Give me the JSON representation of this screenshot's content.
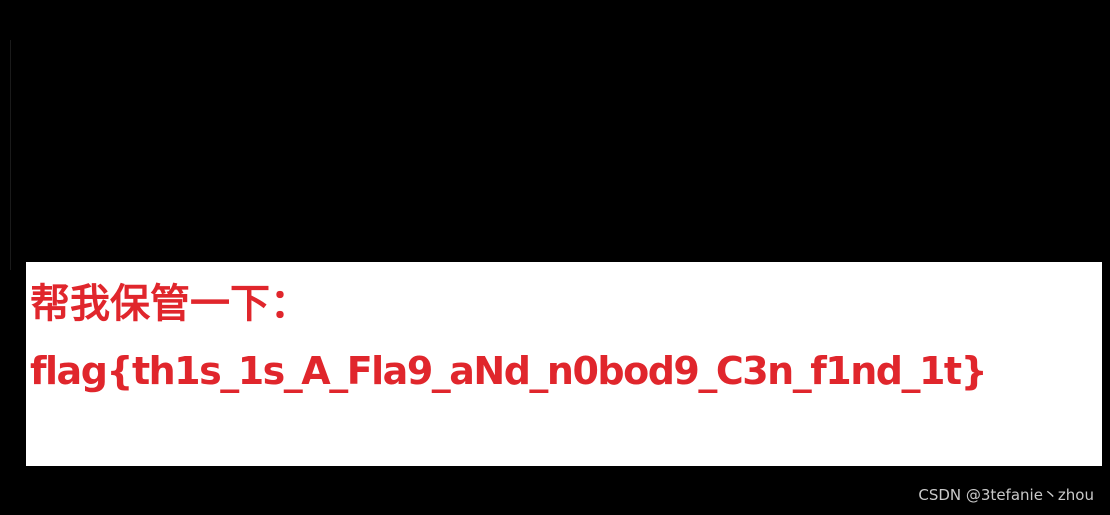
{
  "note": {
    "heading": "帮我保管一下：",
    "flag": "flag{th1s_1s_A_Fla9_aNd_n0bod9_C3n_f1nd_1t}",
    "text_color": "#e0262c",
    "panel_color": "#ffffff"
  },
  "background_color": "#000000",
  "watermark": {
    "text": "CSDN @3tefanie丶zhou"
  }
}
